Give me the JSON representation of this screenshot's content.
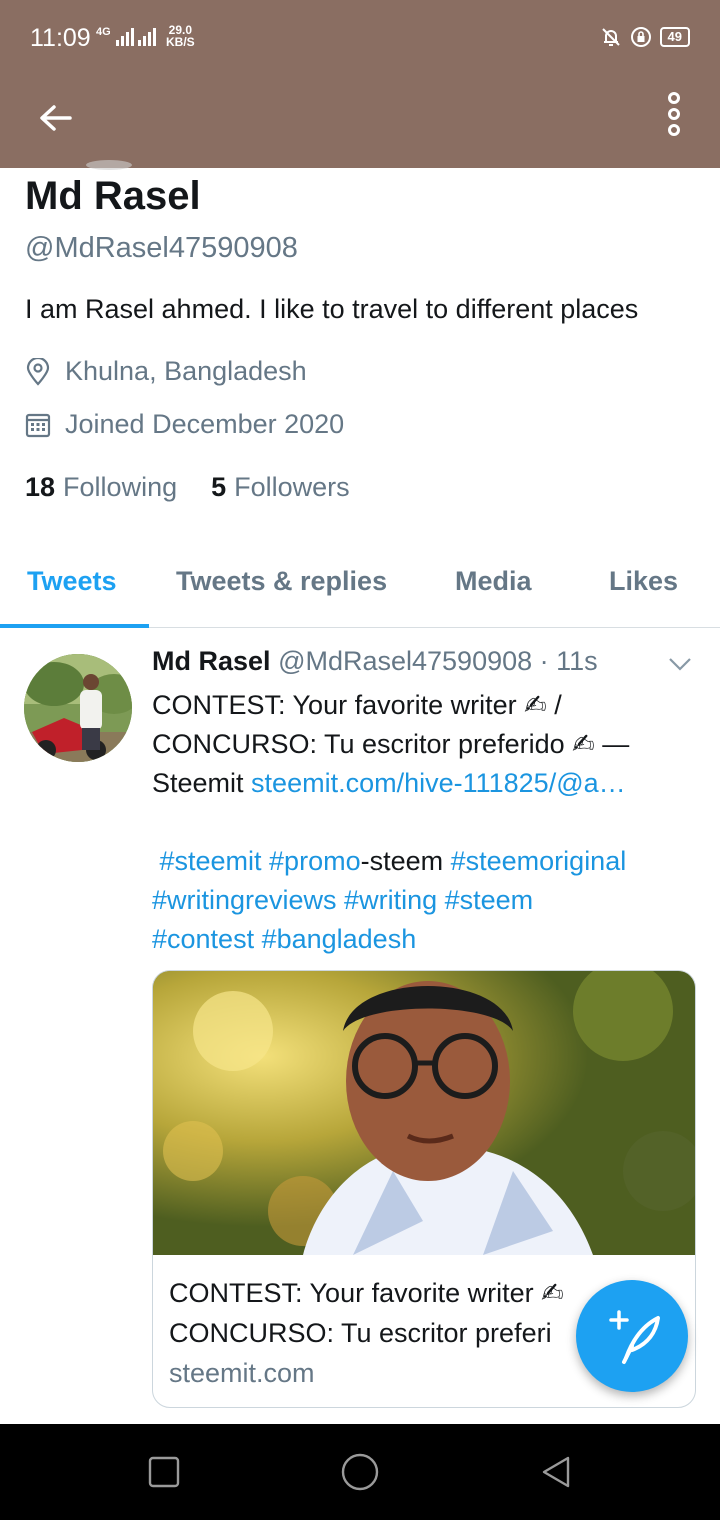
{
  "status_bar": {
    "time": "11:09",
    "network": "4G",
    "speed_value": "29.0",
    "speed_unit": "KB/S",
    "battery": "49"
  },
  "profile": {
    "name": "Md Rasel",
    "handle": "@MdRasel47590908",
    "bio": "I am Rasel ahmed. I like to travel to different places",
    "location": "Khulna, Bangladesh",
    "joined": "Joined December 2020",
    "following_count": "18",
    "following_label": "Following",
    "followers_count": "5",
    "followers_label": "Followers"
  },
  "tabs": [
    {
      "label": "Tweets",
      "active": true
    },
    {
      "label": "Tweets & replies",
      "active": false
    },
    {
      "label": "Media",
      "active": false
    },
    {
      "label": "Likes",
      "active": false
    }
  ],
  "tweet": {
    "author_name": "Md Rasel",
    "author_handle": "@MdRasel47590908",
    "time_ago": "· 11s",
    "line1": "CONTEST: Your favorite writer ✍ /",
    "line2": "CONCURSO: Tu escritor preferido ✍ —",
    "line3_text": "Steemit ",
    "line3_link": "steemit.com/hive-111825/@a…",
    "tags_line1_a": " #steemit #promo",
    "tags_line1_b": "-steem ",
    "tags_line1_c": "#steemoriginal",
    "tags_line2": "#writingreviews #writing #steem",
    "tags_line3": "#contest #bangladesh",
    "card": {
      "title_line1": "CONTEST: Your favorite writer ✍",
      "title_line2": "CONCURSO: Tu escritor preferi",
      "domain": "steemit.com"
    }
  },
  "colors": {
    "app_bar": "#8a6e62",
    "accent": "#1da1f2",
    "link": "#1b95e0",
    "secondary_text": "#657786"
  },
  "icons": [
    "back-arrow-icon",
    "more-vertical-icon",
    "location-pin-icon",
    "calendar-icon",
    "chevron-down-icon",
    "compose-tweet-icon",
    "recent-apps-icon",
    "home-icon",
    "back-triangle-icon",
    "mute-bell-icon",
    "rotation-lock-icon"
  ]
}
